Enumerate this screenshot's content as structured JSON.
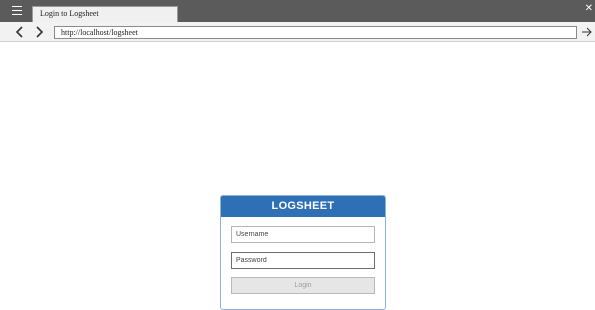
{
  "browser": {
    "tab_title": "Login to Logsheet",
    "url": "http://localhost/logsheet",
    "icons": {
      "menu": "menu-icon",
      "close": "close-icon",
      "back": "back-arrow-icon",
      "forward": "forward-arrow-icon",
      "go": "go-arrow-icon"
    }
  },
  "login": {
    "header": "LOGSHEET",
    "username_placeholder": "Username",
    "password_placeholder": "Password",
    "login_label": "Login",
    "colors": {
      "header": "#2f6fb5",
      "border": "#8fb3d7"
    }
  }
}
